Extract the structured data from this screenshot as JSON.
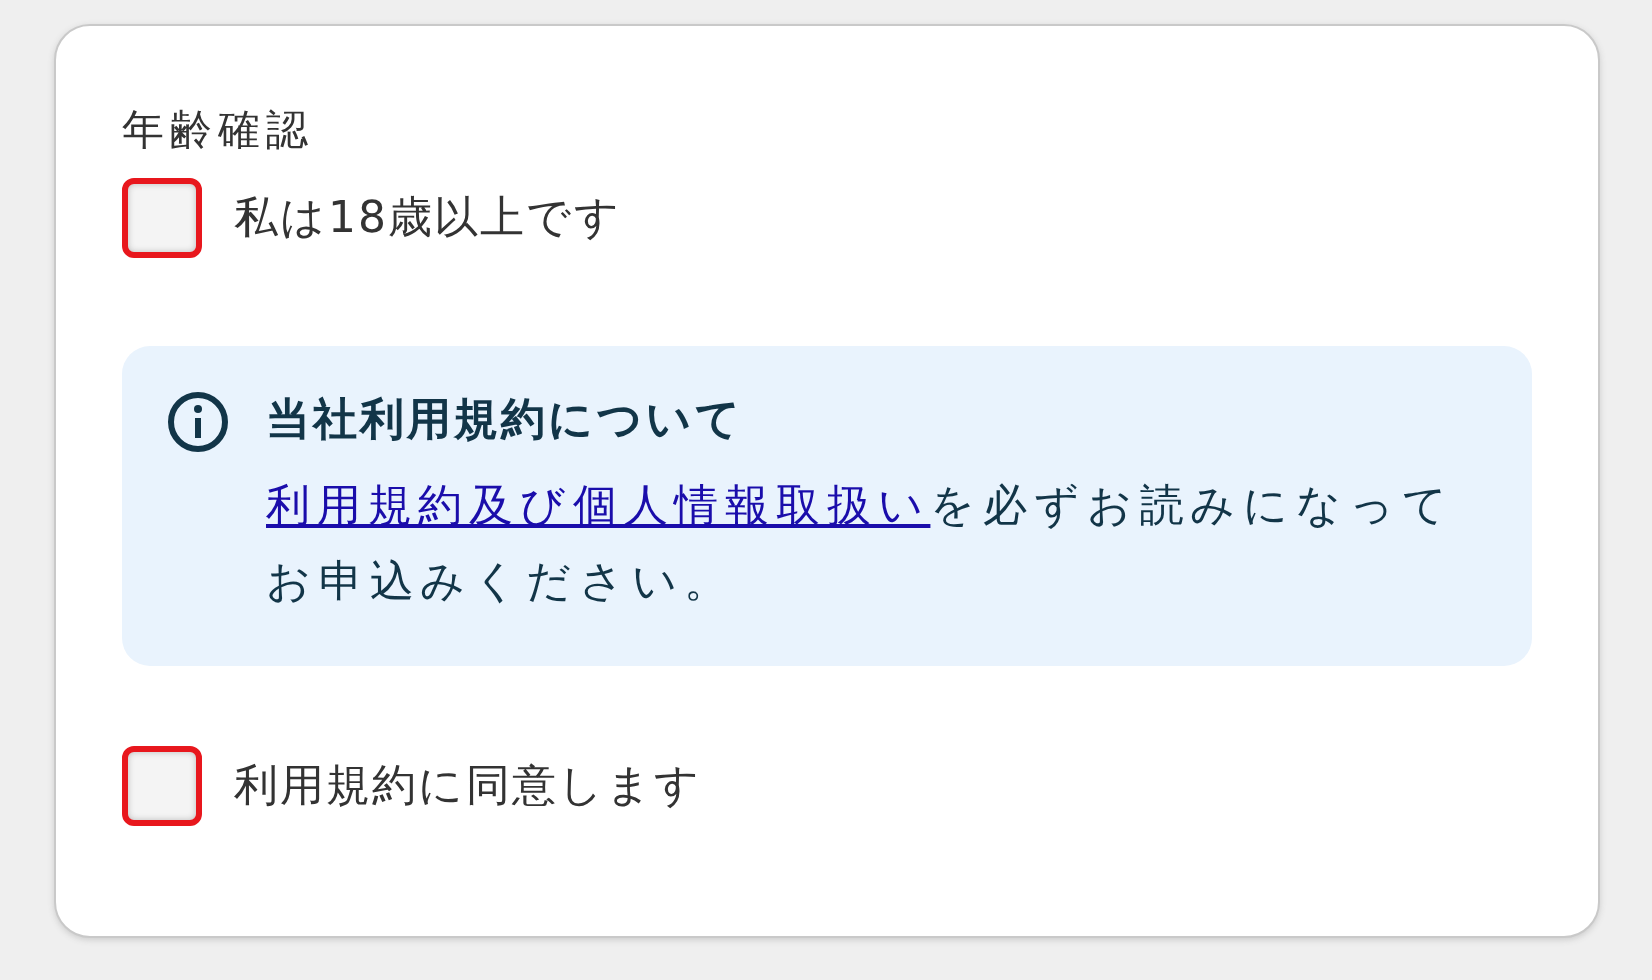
{
  "section_title": "年齢確認",
  "checkboxes": [
    {
      "label": "私は18歳以上です",
      "checked": false
    },
    {
      "label": "利用規約に同意します",
      "checked": false
    }
  ],
  "notice": {
    "title": "当社利用規約について",
    "link": "利用規約及び個人情報取扱い",
    "text": "を必ずお読みになってお申込みください。"
  }
}
